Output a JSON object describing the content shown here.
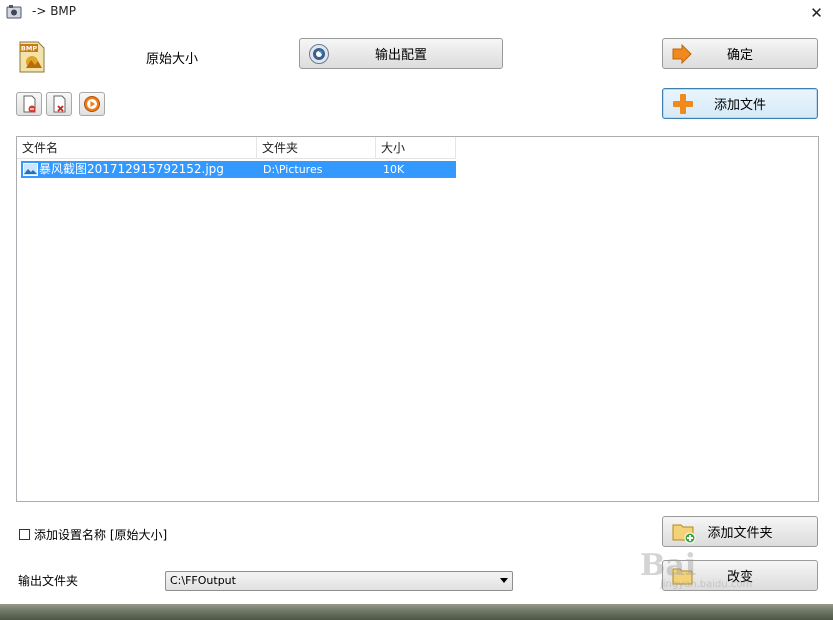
{
  "window": {
    "title": "-> BMP",
    "close_glyph": "✕"
  },
  "header": {
    "format_badge": "BMP",
    "preset_label": "原始大小"
  },
  "buttons": {
    "output_config": "输出配置",
    "ok": "确定",
    "add_file": "添加文件",
    "add_folder": "添加文件夹",
    "change": "改变"
  },
  "toolbar": {
    "icons": [
      "remove-file-icon",
      "clear-list-icon",
      "play-icon"
    ]
  },
  "list": {
    "columns": [
      "文件名",
      "文件夹",
      "大小"
    ],
    "rows": [
      {
        "name": "暴风截图201712915792152.jpg",
        "folder": "D:\\Pictures",
        "size": "10K",
        "selected": true
      }
    ]
  },
  "options": {
    "add_setting_name_label": "添加设置名称 [原始大小]",
    "add_setting_name_checked": false
  },
  "output": {
    "label": "输出文件夹",
    "value": "C:\\FFOutput"
  },
  "watermark": {
    "text": "Bai",
    "sub": "jingyan.baidu.com"
  },
  "colors": {
    "selection": "#3399ff",
    "focus_border": "#3c7fb1",
    "orange_accent": "#f08a1c"
  }
}
